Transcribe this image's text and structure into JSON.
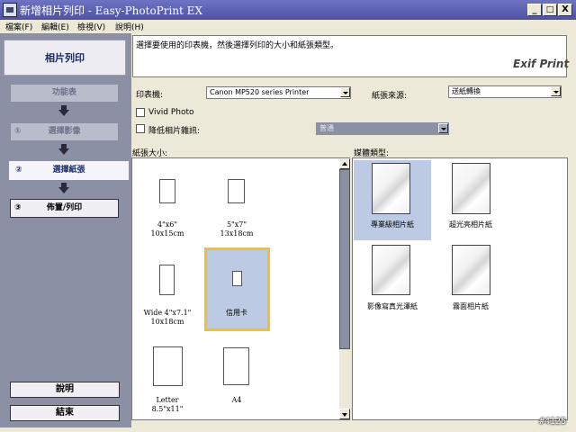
{
  "window": {
    "title": "新增相片列印 - Easy-PhotoPrint EX",
    "minimize": "_",
    "maximize": "□",
    "close": "X"
  },
  "menu": [
    "檔案(F)",
    "編輯(E)",
    "檢視(V)",
    "說明(H)"
  ],
  "sidebar": {
    "title": "相片列印",
    "steps": [
      {
        "label": "功能表"
      },
      {
        "number": "①",
        "label": "選擇影像"
      },
      {
        "number": "②",
        "label": "選擇紙張"
      },
      {
        "number": "③",
        "label": "佈置/列印"
      }
    ],
    "help_label": "說明",
    "exit_label": "結束"
  },
  "instruction": "選擇要使用的印表機，然後選擇列印的大小和紙張類型。",
  "logo_text": "Exif Print",
  "printer": {
    "label": "印表機:",
    "value": "Canon MP520 series Printer"
  },
  "paper_source": {
    "label": "紙張來源:",
    "value": "送紙轉換"
  },
  "vivid_photo": {
    "label": "Vivid Photo",
    "checked": false
  },
  "noise_reduction": {
    "label": "降低相片雜訊:",
    "checked": false,
    "value": "普通"
  },
  "paper_size": {
    "header": "紙張大小:",
    "items": [
      {
        "line1": "4\"x6\"",
        "line2": "10x15cm"
      },
      {
        "line1": "5\"x7\"",
        "line2": "13x18cm"
      },
      {
        "line1": "Wide 4\"x7.1\"",
        "line2": "10x18cm"
      },
      {
        "line1": "信用卡",
        "line2": "",
        "selected": true
      },
      {
        "line1": "Letter",
        "line2": "8.5\"x11\""
      },
      {
        "line1": "A4",
        "line2": ""
      }
    ]
  },
  "media_type": {
    "header": "媒體類型:",
    "items": [
      {
        "label": "專業級相片紙",
        "selected": true
      },
      {
        "label": "超光亮相片紙"
      },
      {
        "label": "影像寫真光澤紙"
      },
      {
        "label": "霧面相片紙"
      }
    ]
  },
  "watermark": "#4125",
  "colors": {
    "titlebar": "#4d52a6",
    "sidebar": "#8c90a4",
    "selection_fill": "#bccbe3",
    "selection_border": "#f0c030"
  }
}
